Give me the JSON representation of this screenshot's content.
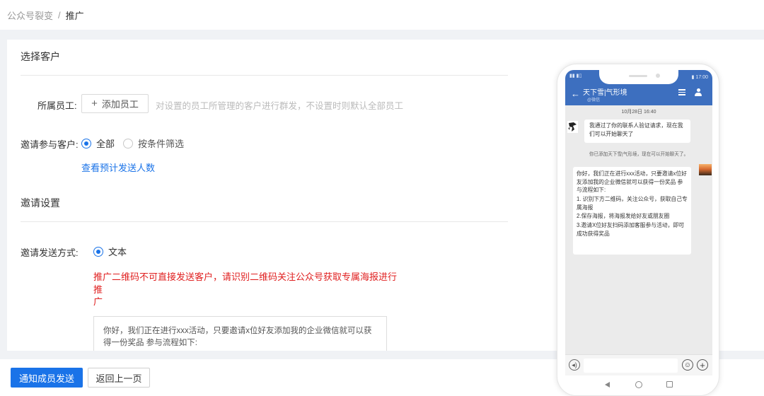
{
  "breadcrumb": {
    "parent": "公众号裂变",
    "separator": "/",
    "current": "推广"
  },
  "section1": {
    "title": "选择客户",
    "staff_label": "所属员工:",
    "add_staff_button": "添加员工",
    "staff_hint": "对设置的员工所管理的客户进行群发，不设置时则默认全部员工",
    "customer_label": "邀请参与客户:",
    "options": [
      "全部",
      "按条件筛选"
    ],
    "selected_option": "全部",
    "preview_link": "查看预计发送人数"
  },
  "section2": {
    "title": "邀请设置",
    "method_label": "邀请发送方式:",
    "method_option": "文本",
    "warning_line1": "推广二维码不可直接发送客户，请识别二维码关注公众号获取专属海报进行推",
    "warning_line2": "广",
    "message_preview": "你好，我们正在进行xxx活动，只要邀请x位好友添加我的企业微信就可以获得一份奖品 参与流程如下:"
  },
  "footer": {
    "primary_button": "通知成员发送",
    "back_button": "返回上一页"
  },
  "phone": {
    "status_left": "▮▮ ▮▯",
    "status_right": "▮ 17:00",
    "chat_title": "天下雪|气形境",
    "chat_subtitle": "@微信",
    "time": "10月28日 16:40",
    "msg1": "我通过了你的联系人验证请求，现在我们可以开始聊天了",
    "system_msg": "你已添加天下雪|气形境，现在可以开始聊天了。",
    "msg2_lines": [
      "你好，我们正在进行xxx活动，只要邀请x位好友添加我的企业微信就可以获得一份奖品 参与流程如下:",
      "1. 识别下方二维码，关注公众号，获取自己专属海报",
      "2.保存海报，将海报发给好友或朋友圈",
      "3.邀请X位好友扫码添加客服参与活动，即可成功获得奖品"
    ]
  },
  "colors": {
    "primary": "#1a73e8",
    "warning": "#e02020",
    "phone_header": "#3d6fbf"
  }
}
